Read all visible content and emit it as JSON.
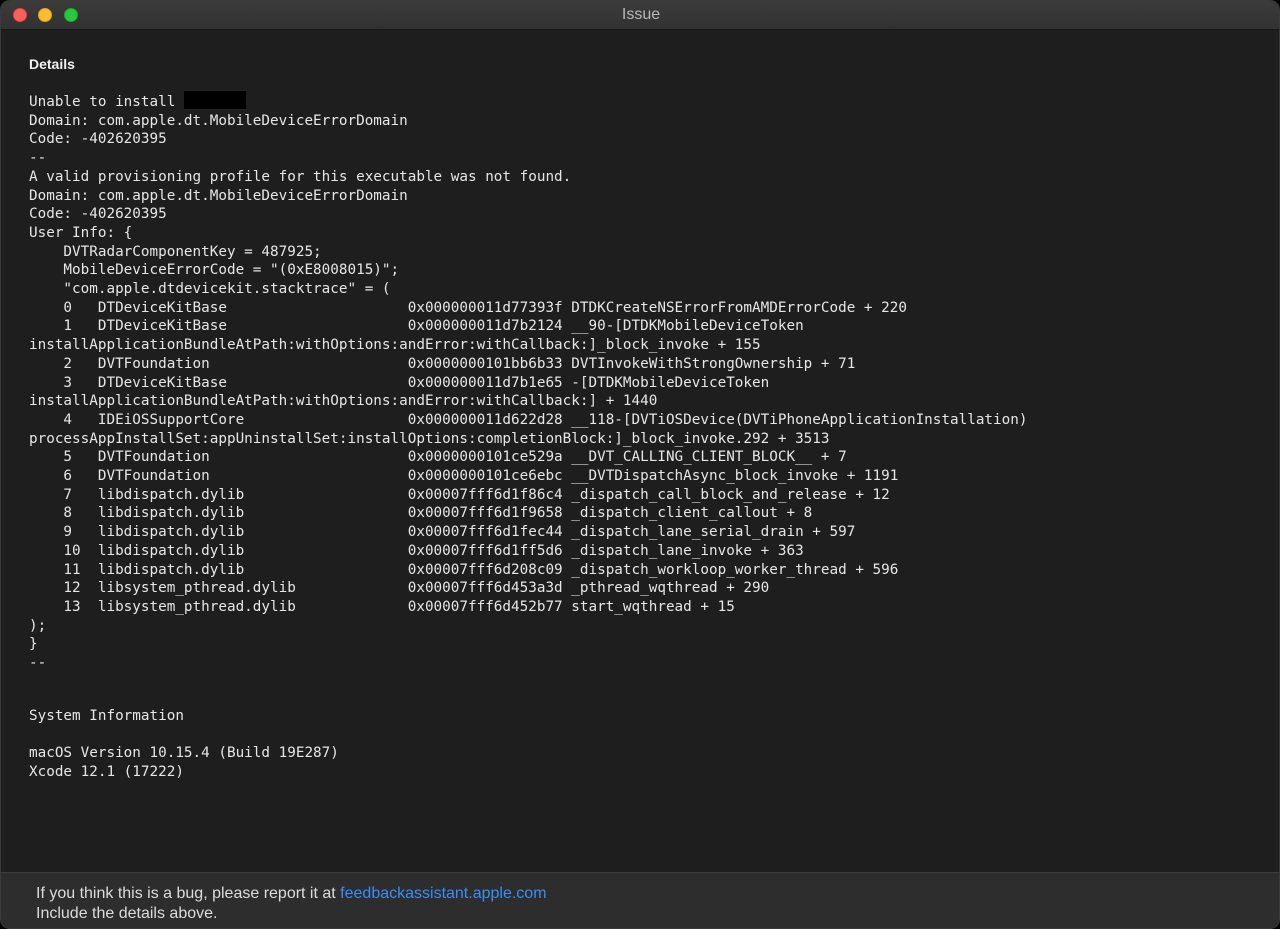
{
  "window": {
    "title": "Issue"
  },
  "details": {
    "heading": "Details",
    "first_line_prefix": "Unable to install ",
    "log_lines": [
      "Domain: com.apple.dt.MobileDeviceErrorDomain",
      "Code: -402620395",
      "--",
      "A valid provisioning profile for this executable was not found.",
      "Domain: com.apple.dt.MobileDeviceErrorDomain",
      "Code: -402620395",
      "User Info: {",
      "    DVTRadarComponentKey = 487925;",
      "    MobileDeviceErrorCode = \"(0xE8008015)\";",
      "    \"com.apple.dtdevicekit.stacktrace\" = (",
      "    0   DTDeviceKitBase                     0x000000011d77393f DTDKCreateNSErrorFromAMDErrorCode + 220",
      "    1   DTDeviceKitBase                     0x000000011d7b2124 __90-[DTDKMobileDeviceToken",
      "installApplicationBundleAtPath:withOptions:andError:withCallback:]_block_invoke + 155",
      "    2   DVTFoundation                       0x0000000101bb6b33 DVTInvokeWithStrongOwnership + 71",
      "    3   DTDeviceKitBase                     0x000000011d7b1e65 -[DTDKMobileDeviceToken",
      "installApplicationBundleAtPath:withOptions:andError:withCallback:] + 1440",
      "    4   IDEiOSSupportCore                   0x000000011d622d28 __118-[DVTiOSDevice(DVTiPhoneApplicationInstallation)",
      "processAppInstallSet:appUninstallSet:installOptions:completionBlock:]_block_invoke.292 + 3513",
      "    5   DVTFoundation                       0x0000000101ce529a __DVT_CALLING_CLIENT_BLOCK__ + 7",
      "    6   DVTFoundation                       0x0000000101ce6ebc __DVTDispatchAsync_block_invoke + 1191",
      "    7   libdispatch.dylib                   0x00007fff6d1f86c4 _dispatch_call_block_and_release + 12",
      "    8   libdispatch.dylib                   0x00007fff6d1f9658 _dispatch_client_callout + 8",
      "    9   libdispatch.dylib                   0x00007fff6d1fec44 _dispatch_lane_serial_drain + 597",
      "    10  libdispatch.dylib                   0x00007fff6d1ff5d6 _dispatch_lane_invoke + 363",
      "    11  libdispatch.dylib                   0x00007fff6d208c09 _dispatch_workloop_worker_thread + 596",
      "    12  libsystem_pthread.dylib             0x00007fff6d453a3d _pthread_wqthread + 290",
      "    13  libsystem_pthread.dylib             0x00007fff6d452b77 start_wqthread + 15",
      ");",
      "}",
      "--"
    ]
  },
  "system_info": {
    "heading": "System Information",
    "macos": "macOS Version 10.15.4 (Build 19E287)",
    "xcode": "Xcode 12.1 (17222)"
  },
  "footer": {
    "bug_prefix": "If you think this is a bug, please report it at ",
    "link": "feedbackassistant.apple.com",
    "instruction": "Include the details above."
  }
}
